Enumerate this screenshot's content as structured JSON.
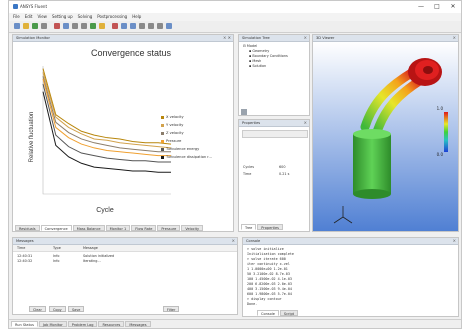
{
  "window": {
    "title": "ANSYS Fluent",
    "buttons": [
      "—",
      "□",
      "✕"
    ]
  },
  "menu": [
    "File",
    "Edit",
    "View",
    "Setting up",
    "Solving",
    "Postprocessing",
    "Help"
  ],
  "colors": {
    "title_bar": "#ffffff",
    "panel_header": "#dce3ec",
    "viewport_top": "#ffffff",
    "viewport_bottom": "#4f7fd3",
    "cylinder": "#3fb83a",
    "cap": "#d81b1b"
  },
  "toolbar": {
    "icons": [
      "new-icon",
      "open-icon",
      "save-icon",
      "print-icon",
      "copy-icon",
      "paste-icon",
      "undo-icon",
      "redo-icon",
      "run-icon",
      "pause-icon",
      "stop-icon",
      "zoom-icon",
      "fit-icon",
      "rotate-icon",
      "pan-icon",
      "settings-icon",
      "help-icon"
    ]
  },
  "convergence_panel": {
    "header": "Simulation Monitor",
    "tabs": [
      "Residuals",
      "Convergence",
      "Mass Balance",
      "Monitor 1",
      "Flow Rate",
      "Pressure",
      "Velocity"
    ],
    "active_tab": 1
  },
  "chart_data": {
    "type": "line",
    "title": "Convergence status",
    "xlabel": "Cycle",
    "ylabel": "Relative fluctuation",
    "ylim": [
      0,
      1
    ],
    "x": [
      0,
      1,
      2,
      3,
      4,
      5,
      6,
      7,
      8,
      9,
      10
    ],
    "legend_position": "right",
    "series": [
      {
        "name": "X velocity",
        "color": "#b8860b",
        "values": [
          0.98,
          0.62,
          0.55,
          0.49,
          0.46,
          0.44,
          0.43,
          0.41,
          0.4,
          0.4,
          0.39
        ]
      },
      {
        "name": "Y velocity",
        "color": "#d2a24c",
        "values": [
          0.95,
          0.6,
          0.52,
          0.47,
          0.43,
          0.42,
          0.4,
          0.39,
          0.38,
          0.37,
          0.36
        ]
      },
      {
        "name": "Z velocity",
        "color": "#8b7d6b",
        "values": [
          0.92,
          0.56,
          0.48,
          0.43,
          0.4,
          0.38,
          0.36,
          0.35,
          0.34,
          0.33,
          0.33
        ]
      },
      {
        "name": "Pressure",
        "color": "#f0a030",
        "values": [
          0.9,
          0.52,
          0.44,
          0.39,
          0.36,
          0.34,
          0.33,
          0.32,
          0.31,
          0.3,
          0.3
        ]
      },
      {
        "name": "Turbulence energy",
        "color": "#555555",
        "values": [
          0.86,
          0.46,
          0.37,
          0.32,
          0.3,
          0.28,
          0.27,
          0.26,
          0.26,
          0.25,
          0.25
        ]
      },
      {
        "name": "Turbulence dissipation r...",
        "color": "#1a1a1a",
        "values": [
          0.8,
          0.38,
          0.29,
          0.24,
          0.21,
          0.2,
          0.19,
          0.18,
          0.18,
          0.17,
          0.17
        ]
      }
    ]
  },
  "simulation_tree": {
    "header": "Simulation Tree",
    "items": [
      "Model",
      "Geometry",
      "Boundary Conditions",
      "Mesh",
      "Solution"
    ]
  },
  "properties": {
    "header": "Properties",
    "rows": [
      {
        "label": "Cycles",
        "value": "600"
      },
      {
        "label": "Time",
        "value": "0.21 s"
      }
    ],
    "tabs": [
      "Tree",
      "Properties"
    ]
  },
  "viewport": {
    "header": "3D Viewer",
    "colorbar_max": "1.0",
    "colorbar_min": "0.0"
  },
  "output_panel": {
    "header": "Messages",
    "columns": [
      "Time",
      "Type",
      "Message"
    ],
    "rows": [
      {
        "time": "12:40:31",
        "type": "Info",
        "message": "Solution initialized"
      },
      {
        "time": "12:40:32",
        "type": "Info",
        "message": "Iterating..."
      }
    ],
    "buttons": [
      "Clear",
      "Copy",
      "Save",
      "Filter"
    ]
  },
  "console_panel": {
    "header": "Console",
    "lines": [
      "> solve initialize",
      "  Initialization complete",
      "> solve iterate 600",
      "  iter  continuity  x-vel",
      "     1  1.0000e+00  1.2e-01",
      "    50  3.2100e-02  8.7e-03",
      "   100  1.4500e-02  4.1e-03",
      "   200  6.8200e-03  2.0e-03",
      "   400  3.1500e-03  9.4e-04",
      "   600  1.9800e-03  5.7e-04",
      "> display contour",
      "  Done."
    ],
    "tabs": [
      "Console",
      "Script"
    ]
  },
  "status_bar": {
    "tabs": [
      "Run Status",
      "Job Monitor",
      "Problem Log",
      "Resources",
      "Messages"
    ]
  }
}
